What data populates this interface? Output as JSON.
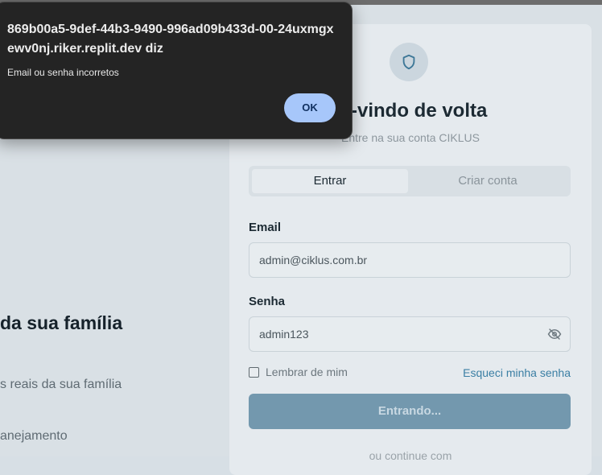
{
  "dialog": {
    "title": "869b00a5-9def-44b3-9490-996ad09b433d-00-24uxmgxewv0nj.riker.replit.dev diz",
    "message": "Email ou senha incorretos",
    "ok_label": "OK"
  },
  "left_panel": {
    "heading": "da sua família",
    "line1": "s reais da sua família",
    "line2": "anejamento"
  },
  "card": {
    "shield_icon": "shield-icon",
    "title": "m-vindo de volta",
    "subtitle": "Entre na sua conta CIKLUS",
    "tabs": [
      {
        "label": "Entrar",
        "active": true
      },
      {
        "label": "Criar conta",
        "active": false
      }
    ],
    "email": {
      "label": "Email",
      "value": "admin@ciklus.com.br"
    },
    "password": {
      "label": "Senha",
      "value": "admin123",
      "toggle_icon": "eye-off-icon"
    },
    "remember_label": "Lembrar de mim",
    "forgot_label": "Esqueci minha senha",
    "submit_label": "Entrando...",
    "divider_text": "ou continue com"
  },
  "colors": {
    "accent": "#3b7fa4",
    "submit_bg": "#7398ae",
    "dialog_bg": "#242424",
    "ok_button": "#a7c7fa"
  }
}
